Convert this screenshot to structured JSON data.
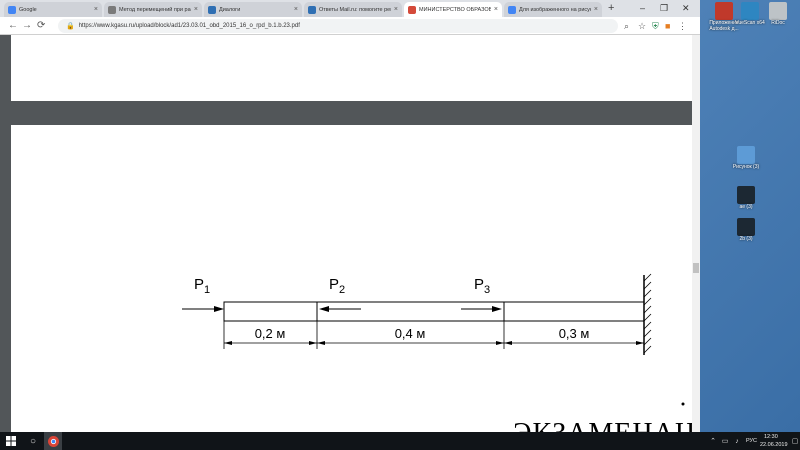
{
  "browser": {
    "tabs": [
      {
        "title": "Google",
        "color": "#4285f4"
      },
      {
        "title": "Метод перемещений при расч",
        "color": "#7a7a7a"
      },
      {
        "title": "Диалоги",
        "color": "#2f6fb3"
      },
      {
        "title": "Ответы Mail.ru: помогите реш",
        "color": "#2f6fb3"
      },
      {
        "title": "МИНИСТЕРСТВО ОБРАЗОВАНИ",
        "color": "#d44a3a"
      },
      {
        "title": "Для изображенного на рисунк",
        "color": "#4285f4"
      }
    ],
    "active_tab": 4,
    "url": "https://www.kgasu.ru/upload/block/ad1/23.03.01_obd_2015_16_o_rpd_b.1.b.23.pdf"
  },
  "diagram": {
    "forces": [
      "P",
      "P",
      "P"
    ],
    "force_subscripts": [
      "1",
      "2",
      "3"
    ],
    "segments": [
      "0,2 м",
      "0,4 м",
      "0,3 м"
    ]
  },
  "page_text": {
    "exam": "ЭКЗАМЕНАЦ"
  },
  "desktop": {
    "icons": [
      {
        "label": "Приложение Autodesk д...",
        "color": "#c0392b"
      },
      {
        "label": "VueScan x64",
        "color": "#2e86c1"
      },
      {
        "label": "RiDoc",
        "color": "#7f8c8d"
      },
      {
        "label": "Рисунок (3)",
        "color": "#5d9bd6"
      },
      {
        "label": "ae (3)",
        "color": "#1c2833"
      },
      {
        "label": "2b (3)",
        "color": "#1c2833"
      }
    ]
  },
  "taskbar": {
    "lang": "РУС",
    "time": "12:30",
    "date": "22.06.2019"
  }
}
